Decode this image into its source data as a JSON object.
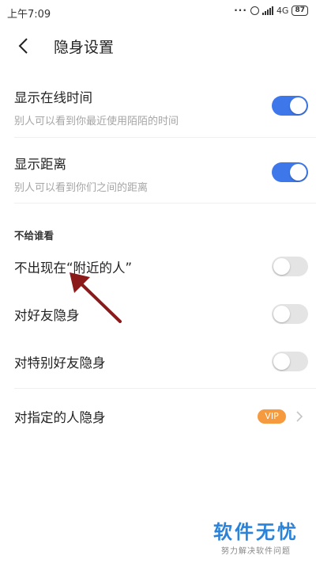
{
  "status_bar": {
    "time": "上午7:09",
    "network": "4G",
    "battery": "87"
  },
  "header": {
    "title": "隐身设置"
  },
  "settings": [
    {
      "label": "显示在线时间",
      "sub": "别人可以看到你最近使用陌陌的时间",
      "on": true
    },
    {
      "label": "显示距离",
      "sub": "别人可以看到你们之间的距离",
      "on": true
    }
  ],
  "section": {
    "title": "不给谁看"
  },
  "hide_rows": [
    {
      "label": "不出现在“附近的人”",
      "on": false
    },
    {
      "label": "对好友隐身",
      "on": false
    },
    {
      "label": "对特别好友隐身",
      "on": false
    }
  ],
  "specified": {
    "label": "对指定的人隐身",
    "badge": "VIP"
  },
  "watermark": {
    "main": "软件无忧",
    "sub": "努力解决软件问题"
  },
  "colors": {
    "accent": "#3d77ea",
    "vip": "#f59a3e",
    "arrow": "#8b1a1a"
  }
}
